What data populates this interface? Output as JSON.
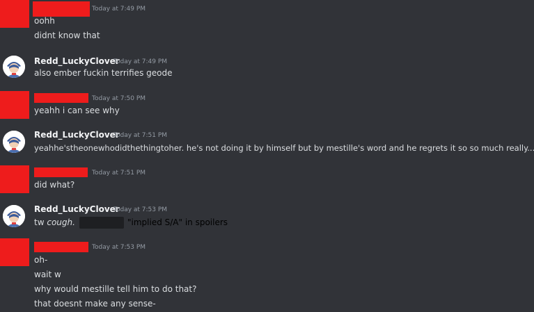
{
  "messages": [
    {
      "author_label": "",
      "timestamp": "Today at 7:49 PM",
      "lines": [
        "oohh",
        "didnt know that"
      ]
    },
    {
      "author_label": "Redd_LuckyClover",
      "timestamp": "Today at 7:49 PM",
      "lines": [
        "also ember fuckin terrifies geode"
      ]
    },
    {
      "author_label": "",
      "timestamp": "Today at 7:50 PM",
      "lines": [
        "yeahh i can see why"
      ]
    },
    {
      "author_label": "Redd_LuckyClover",
      "timestamp": "Today at 7:51 PM",
      "lines": [
        "yeahhe'stheonewhodidthethingtoher. he's not doing it by himself but by mestille's word and he regrets it so so much really..."
      ]
    },
    {
      "author_label": "",
      "timestamp": "Today at 7:51 PM",
      "lines": [
        "did what?"
      ]
    },
    {
      "author_label": "Redd_LuckyClover",
      "timestamp": "Today at 7:53 PM",
      "prefix": "tw ",
      "emphasis": "cough.",
      "overlay_note": "\"implied S/A\" in spoilers"
    },
    {
      "author_label": "",
      "timestamp": "Today at 7:53 PM",
      "lines": [
        "oh-",
        "wait w",
        "why would mestille tell him to do that?",
        "that doesnt make any sense-"
      ]
    }
  ],
  "colors": {
    "background": "#313338",
    "redaction": "#ee1c1c",
    "spoiler": "#1e1f22",
    "username": "#f2f3f5",
    "timestamp": "#949ba4",
    "text": "#dbdee1"
  },
  "icons": {
    "avatar": "anime-character-avatar-icon"
  }
}
